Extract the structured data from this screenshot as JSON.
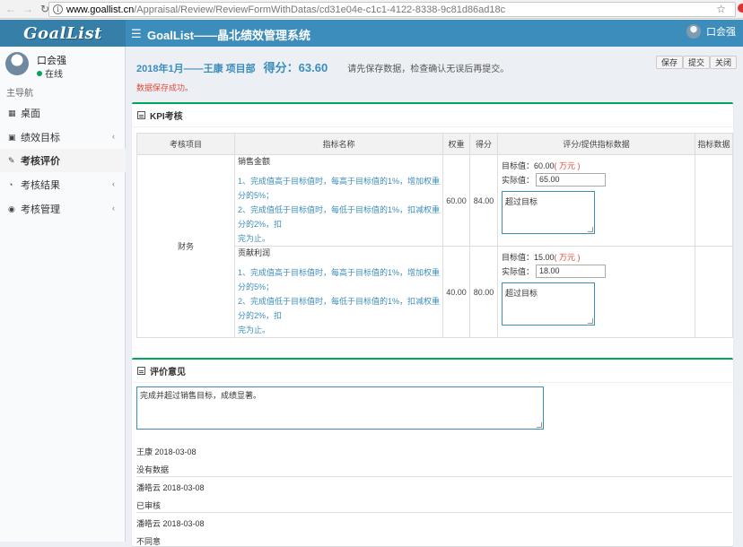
{
  "browser": {
    "url_domain": "www.goallist.cn",
    "url_path": "/Appraisal/Review/ReviewFormWithDatas/cd31e04e-c1c1-4122-8338-9c81d86ad18c"
  },
  "header": {
    "logo_text": "GoalList",
    "title": "GoalList——晶北绩效管理系统",
    "user_name": "口会强"
  },
  "sidebar": {
    "user_name": "口会强",
    "status": "在线",
    "section_title": "主导航",
    "items": [
      {
        "label": "桌面",
        "icon": "grid-icon"
      },
      {
        "label": "绩效目标",
        "icon": "book-icon"
      },
      {
        "label": "考核评价",
        "icon": "edit-icon"
      },
      {
        "label": "考核结果",
        "icon": "pie-icon"
      },
      {
        "label": "考核管理",
        "icon": "gauge-icon"
      }
    ]
  },
  "page": {
    "period": "2018年1月——王康  项目部",
    "score": "得分：63.60",
    "hint": "请先保存数据，检查确认无误后再提交。",
    "save_button": "保存",
    "submit_button": "提交",
    "close_button": "关闭",
    "save_message": "数据保存成功。"
  },
  "kpi": {
    "title": "KPI考核",
    "columns": [
      "考核项目",
      "指标名称",
      "权重",
      "得分",
      "评分/提供指标数据",
      "指标数据"
    ],
    "category": "财务",
    "rows": [
      {
        "name": "销售金额",
        "rule1": "1、完成值高于目标值时，每高于目标值的1%，增加权重分的5%；",
        "rule2a": "2、完成值低于目标值时，每低于目标值的1%，扣减权重分的2%，扣",
        "rule2b": "完为止。",
        "weight": "60.00",
        "score": "84.00",
        "target_label": "目标值：60.00",
        "unit": "( 万元 )",
        "actual_label": "实际值：",
        "actual_value": "65.00",
        "comment": "超过目标"
      },
      {
        "name": "贡献利润",
        "rule1": "1、完成值高于目标值时，每高于目标值的1%，增加权重分的5%；",
        "rule2a": "2、完成值低于目标值时，每低于目标值的1%，扣减权重分的2%，扣",
        "rule2b": "完为止。",
        "weight": "40.00",
        "score": "80.00",
        "target_label": "目标值：15.00",
        "unit": "( 万元 )",
        "actual_label": "实际值：",
        "actual_value": "18.00",
        "comment": "超过目标"
      }
    ]
  },
  "opinion": {
    "title": "评价意见",
    "text": "完成并超过销售目标，成绩显著。",
    "comments": [
      {
        "author_date": "王康  2018-03-08",
        "text": "没有数据"
      },
      {
        "author_date": "潘皓云  2018-03-08",
        "text": "已审核"
      },
      {
        "author_date": "潘皓云  2018-03-08",
        "text": "不同意"
      }
    ]
  }
}
